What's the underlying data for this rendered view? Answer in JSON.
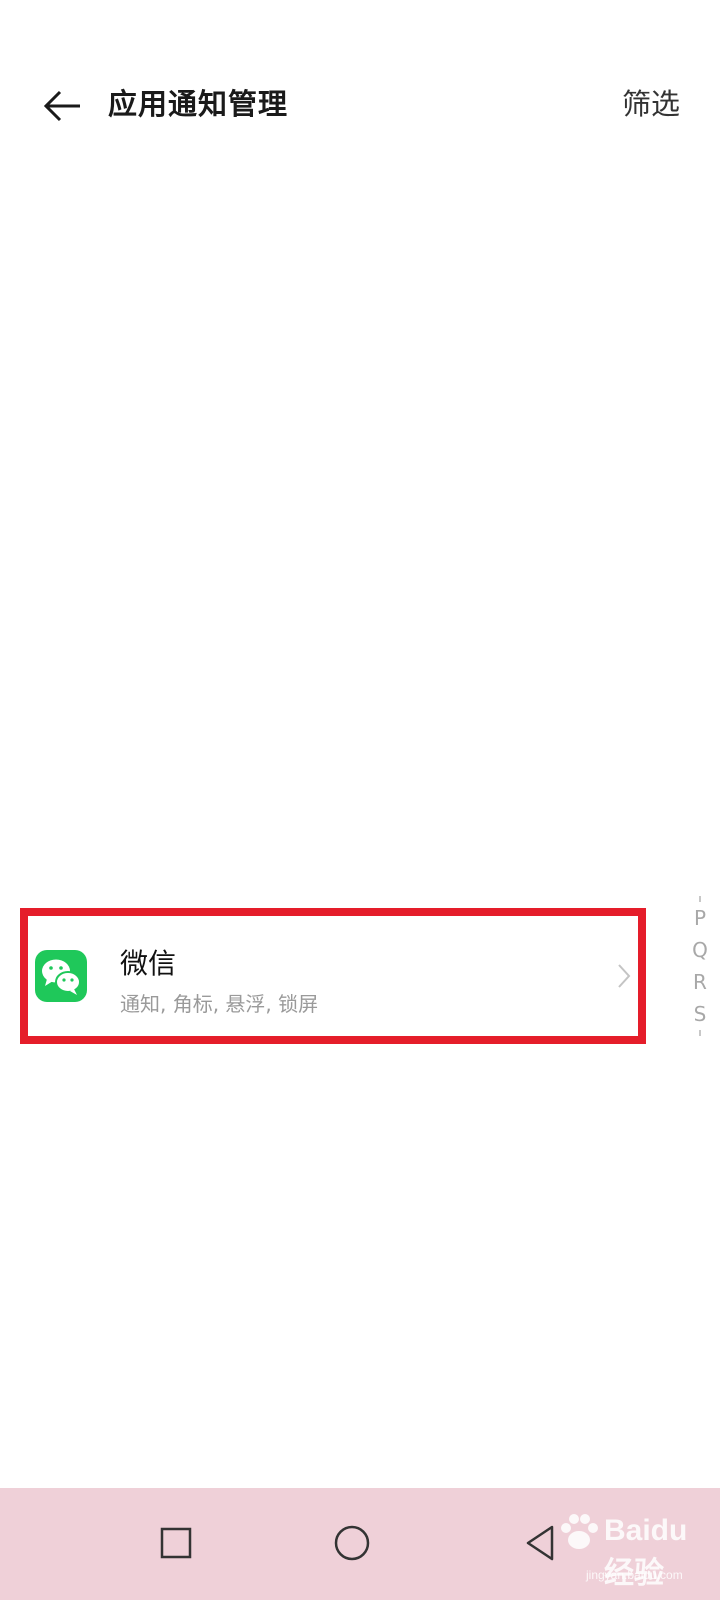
{
  "header": {
    "title": "应用通知管理",
    "filter_label": "筛选"
  },
  "app_list": [
    {
      "name": "微信",
      "description": "通知, 角标, 悬浮, 锁屏",
      "icon": "wechat-icon",
      "icon_color": "#1FC85A"
    }
  ],
  "alpha_index": [
    "P",
    "Q",
    "R",
    "S"
  ],
  "highlight_color": "#E51D2A",
  "navbar": {
    "background": "#EFD0D8",
    "buttons": [
      "recent-apps-icon",
      "home-icon",
      "back-icon"
    ]
  },
  "watermark": {
    "brand": "Baidu经验",
    "url": "jingyan.baidu.com"
  }
}
